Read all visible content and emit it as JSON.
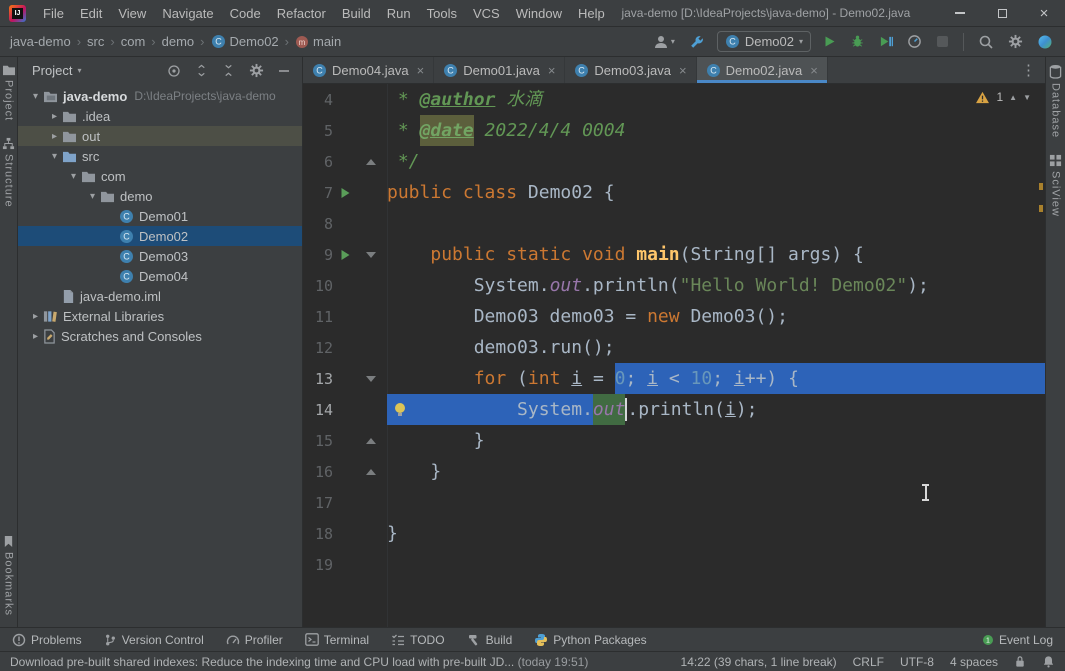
{
  "title_bar": {
    "app_icon": "intellij-logo",
    "menus": [
      "File",
      "Edit",
      "View",
      "Navigate",
      "Code",
      "Refactor",
      "Build",
      "Run",
      "Tools",
      "VCS",
      "Window",
      "Help"
    ],
    "title": "java-demo [D:\\IdeaProjects\\java-demo] - Demo02.java"
  },
  "nav_bar": {
    "breadcrumbs": [
      {
        "label": "java-demo"
      },
      {
        "label": "src"
      },
      {
        "label": "com"
      },
      {
        "label": "demo"
      },
      {
        "label": "Demo02",
        "icon": "class"
      },
      {
        "label": "main",
        "icon": "method"
      }
    ],
    "run_config": "Demo02",
    "group1": [
      {
        "name": "user-profile",
        "icon": "person",
        "caret": true
      },
      {
        "name": "build-project",
        "icon": "wrench"
      }
    ],
    "group2": [
      {
        "name": "run",
        "icon": "play"
      },
      {
        "name": "debug",
        "icon": "bug"
      },
      {
        "name": "run-with-coverage",
        "icon": "coverage"
      },
      {
        "name": "run-with-profiler",
        "icon": "profiler-run"
      },
      {
        "name": "stop",
        "icon": "stop",
        "disabled": true
      }
    ],
    "group3": [
      {
        "name": "search-everywhere",
        "icon": "search"
      },
      {
        "name": "settings",
        "icon": "gear"
      },
      {
        "name": "code-with-me",
        "icon": "sphere"
      }
    ]
  },
  "left_stripe": {
    "top": [
      {
        "label": "Project",
        "icon": "project-tool"
      },
      {
        "label": "Structure",
        "icon": "structure"
      }
    ],
    "bottom": [
      {
        "label": "Bookmarks",
        "icon": "bookmark"
      }
    ]
  },
  "right_stripe": {
    "top": [
      {
        "label": "Database",
        "icon": "database"
      },
      {
        "label": "SciView",
        "icon": "grid"
      }
    ]
  },
  "project_panel": {
    "header": "Project",
    "header_icons": [
      {
        "name": "locate-file",
        "icon": "target"
      },
      {
        "name": "expand-all",
        "icon": "expand"
      },
      {
        "name": "collapse-all",
        "icon": "collapse"
      },
      {
        "name": "panel-settings",
        "icon": "gear"
      },
      {
        "name": "hide-panel",
        "icon": "minus"
      }
    ],
    "tree": [
      {
        "depth": 0,
        "chevron": "open",
        "icon": "project-folder",
        "label": "java-demo",
        "sublabel": "D:\\IdeaProjects\\java-demo",
        "bold": true
      },
      {
        "depth": 1,
        "chevron": "closed",
        "icon": "folder",
        "label": ".idea"
      },
      {
        "depth": 1,
        "chevron": "closed",
        "icon": "folder",
        "label": "out",
        "selected": "inactive"
      },
      {
        "depth": 1,
        "chevron": "open",
        "icon": "folder-src",
        "label": "src"
      },
      {
        "depth": 2,
        "chevron": "open",
        "icon": "folder",
        "label": "com"
      },
      {
        "depth": 3,
        "chevron": "open",
        "icon": "folder",
        "label": "demo"
      },
      {
        "depth": 4,
        "chevron": null,
        "icon": "class",
        "label": "Demo01"
      },
      {
        "depth": 4,
        "chevron": null,
        "icon": "class",
        "label": "Demo02",
        "selected": "active"
      },
      {
        "depth": 4,
        "chevron": null,
        "icon": "class",
        "label": "Demo03"
      },
      {
        "depth": 4,
        "chevron": null,
        "icon": "class",
        "label": "Demo04"
      },
      {
        "depth": 1,
        "chevron": null,
        "icon": "iml-file",
        "label": "java-demo.iml"
      },
      {
        "depth": 0,
        "chevron": "closed",
        "icon": "library",
        "label": "External Libraries"
      },
      {
        "depth": 0,
        "chevron": "closed",
        "icon": "scratches",
        "label": "Scratches and Consoles"
      }
    ]
  },
  "editor": {
    "tabs": [
      {
        "label": "Demo04.java",
        "icon": "class"
      },
      {
        "label": "Demo01.java",
        "icon": "class"
      },
      {
        "label": "Demo03.java",
        "icon": "class"
      },
      {
        "label": "Demo02.java",
        "icon": "class",
        "active": true
      }
    ],
    "inspection": {
      "warning_count": "1"
    },
    "lines": [
      {
        "num": "4",
        "gutter": [],
        "seg": [
          {
            "t": " * ",
            "c": "d"
          },
          {
            "t": "@author",
            "c": "dt"
          },
          {
            "t": " 水滴",
            "c": "d"
          }
        ]
      },
      {
        "num": "5",
        "gutter": [],
        "seg": [
          {
            "t": " * ",
            "c": "d"
          },
          {
            "t": "@date",
            "c": "dth"
          },
          {
            "t": " 2022/4/4 0004",
            "c": "d"
          }
        ]
      },
      {
        "num": "6",
        "gutter": [
          "fold-end"
        ],
        "seg": [
          {
            "t": " */",
            "c": "d"
          }
        ]
      },
      {
        "num": "7",
        "gutter": [
          "run"
        ],
        "seg": [
          {
            "t": "public class ",
            "c": "k"
          },
          {
            "t": "Demo02 {",
            "c": "p"
          }
        ]
      },
      {
        "num": "8",
        "gutter": [],
        "seg": []
      },
      {
        "num": "9",
        "gutter": [
          "run",
          "fold-start"
        ],
        "seg": [
          {
            "t": "    ",
            "c": "p"
          },
          {
            "t": "public static void ",
            "c": "k"
          },
          {
            "t": "main",
            "c": "m"
          },
          {
            "t": "(String[] args) {",
            "c": "p"
          }
        ]
      },
      {
        "num": "10",
        "gutter": [],
        "seg": [
          {
            "t": "        System.",
            "c": "p"
          },
          {
            "t": "out",
            "c": "sf"
          },
          {
            "t": ".println(",
            "c": "p"
          },
          {
            "t": "\"Hello World! Demo02\"",
            "c": "s"
          },
          {
            "t": ");",
            "c": "p"
          }
        ]
      },
      {
        "num": "11",
        "gutter": [],
        "seg": [
          {
            "t": "        Demo03 demo03 = ",
            "c": "p"
          },
          {
            "t": "new",
            "c": "k"
          },
          {
            "t": " Demo03();",
            "c": "p"
          }
        ]
      },
      {
        "num": "12",
        "gutter": [],
        "seg": [
          {
            "t": "        demo03.run();",
            "c": "p"
          }
        ]
      },
      {
        "num": "13",
        "gutter": [
          "fold-start"
        ],
        "active": true,
        "selEol": true,
        "seg": [
          {
            "t": "        ",
            "c": "p"
          },
          {
            "t": "for",
            "c": "k"
          },
          {
            "t": " (",
            "c": "p"
          },
          {
            "t": "int",
            "c": "k"
          },
          {
            "t": " ",
            "c": "p"
          },
          {
            "t": "i",
            "c": "vu"
          },
          {
            "t": " = ",
            "c": "p"
          },
          {
            "t": "0",
            "c": "n",
            "sel": true
          },
          {
            "t": "; ",
            "c": "p",
            "sel": true
          },
          {
            "t": "i",
            "c": "vu",
            "sel": true
          },
          {
            "t": " < ",
            "c": "p",
            "sel": true
          },
          {
            "t": "10",
            "c": "n",
            "sel": true
          },
          {
            "t": "; ",
            "c": "p",
            "sel": true
          },
          {
            "t": "i",
            "c": "vu",
            "sel": true
          },
          {
            "t": "++) {",
            "c": "p",
            "sel": true
          }
        ]
      },
      {
        "num": "14",
        "gutter": [],
        "active": true,
        "bulb": true,
        "caretAfter": 2,
        "seg": [
          {
            "t": "            System.",
            "c": "p",
            "sel": true
          },
          {
            "t": "out",
            "c": "sf",
            "hl": true
          },
          {
            "t": ".println(",
            "c": "p"
          },
          {
            "t": "i",
            "c": "vu"
          },
          {
            "t": ");",
            "c": "p"
          }
        ]
      },
      {
        "num": "15",
        "gutter": [
          "fold-end"
        ],
        "seg": [
          {
            "t": "        }",
            "c": "p"
          }
        ]
      },
      {
        "num": "16",
        "gutter": [
          "fold-end"
        ],
        "seg": [
          {
            "t": "    }",
            "c": "p"
          }
        ]
      },
      {
        "num": "17",
        "gutter": [],
        "seg": []
      },
      {
        "num": "18",
        "gutter": [],
        "seg": [
          {
            "t": "}",
            "c": "p"
          }
        ]
      },
      {
        "num": "19",
        "gutter": [],
        "seg": []
      }
    ]
  },
  "bottom_bar": {
    "items": [
      {
        "label": "Problems",
        "icon": "problems"
      },
      {
        "label": "Version Control",
        "icon": "branch"
      },
      {
        "label": "Profiler",
        "icon": "gauge"
      },
      {
        "label": "Terminal",
        "icon": "terminal"
      },
      {
        "label": "TODO",
        "icon": "todo"
      },
      {
        "label": "Build",
        "icon": "hammer"
      },
      {
        "label": "Python Packages",
        "icon": "python"
      }
    ],
    "right": {
      "label": "Event Log",
      "icon": "green-dot"
    }
  },
  "status_bar": {
    "message": "Download pre-built shared indexes: Reduce the indexing time and CPU load with pre-built JD...",
    "timestamp": "(today 19:51)",
    "caret_position": "14:22 (39 chars, 1 line break)",
    "line_separator": "CRLF",
    "encoding": "UTF-8",
    "indent": "4 spaces"
  },
  "colors": {
    "selection": "#2d63b8",
    "tab_accent": "#4A88C7",
    "keyword": "#cc7832",
    "string": "#6a8759",
    "number": "#6897bb",
    "comment": "#629755",
    "run_green": "#499C54",
    "warning": "#d9a343"
  }
}
